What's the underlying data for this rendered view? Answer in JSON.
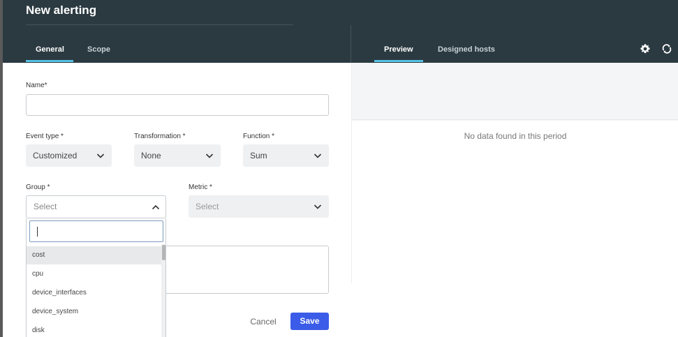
{
  "header": {
    "title": "New alerting",
    "left_tabs": [
      {
        "label": "General",
        "active": true
      },
      {
        "label": "Scope",
        "active": false
      }
    ],
    "right_tabs": [
      {
        "label": "Preview",
        "active": true
      },
      {
        "label": "Designed hosts",
        "active": false
      }
    ],
    "icons": [
      "gear-icon",
      "refresh-icon"
    ]
  },
  "form": {
    "name": {
      "label": "Name*",
      "value": "",
      "placeholder": ""
    },
    "event_type": {
      "label": "Event type *",
      "value": "Customized"
    },
    "transformation": {
      "label": "Transformation *",
      "value": "None"
    },
    "function": {
      "label": "Function *",
      "value": "Sum"
    },
    "group": {
      "label": "Group *",
      "placeholder": "Select",
      "search_value": "",
      "options": [
        "cost",
        "cpu",
        "device_interfaces",
        "device_system",
        "disk"
      ],
      "hovered_option": "cost"
    },
    "metric": {
      "label": "Metric *",
      "placeholder": "Select"
    },
    "cancel_label": "Cancel",
    "save_label": "Save"
  },
  "preview": {
    "empty_message": "No data found in this period"
  },
  "colors": {
    "header_bg": "#2b3a41",
    "tab_underline": "#56c2e6",
    "primary_button": "#3b5ce8",
    "select_bg": "#eef0f2"
  }
}
